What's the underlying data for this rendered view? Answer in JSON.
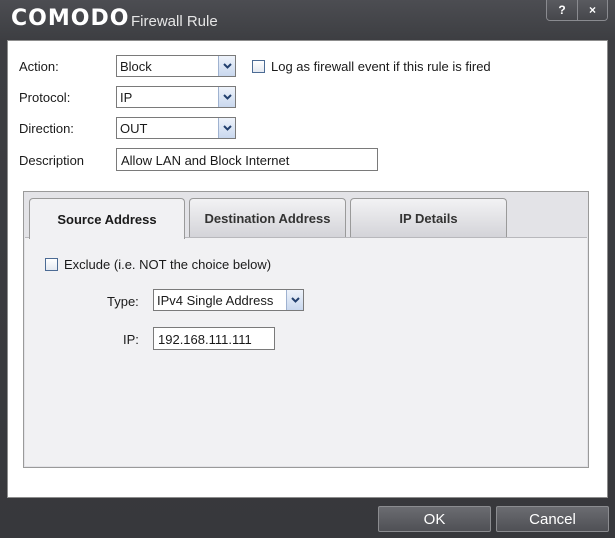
{
  "window": {
    "brand": "COMODO",
    "title": "Firewall Rule",
    "help_label": "?",
    "close_label": "×"
  },
  "form": {
    "action_label": "Action:",
    "action_value": "Block",
    "log_label": "Log as firewall event if this rule is fired",
    "log_checked": false,
    "protocol_label": "Protocol:",
    "protocol_value": "IP",
    "direction_label": "Direction:",
    "direction_value": "OUT",
    "description_label": "Description",
    "description_value": "Allow LAN and Block Internet"
  },
  "tabs": [
    {
      "label": "Source Address",
      "active": true
    },
    {
      "label": "Destination Address",
      "active": false
    },
    {
      "label": "IP Details",
      "active": false
    }
  ],
  "source": {
    "exclude_label": "Exclude (i.e. NOT the choice below)",
    "exclude_checked": false,
    "type_label": "Type:",
    "type_value": "IPv4 Single Address",
    "ip_label": "IP:",
    "ip_value": "192.168.111.111"
  },
  "buttons": {
    "ok": "OK",
    "cancel": "Cancel"
  },
  "icons": {
    "dropdown": "chevron-down-icon"
  }
}
